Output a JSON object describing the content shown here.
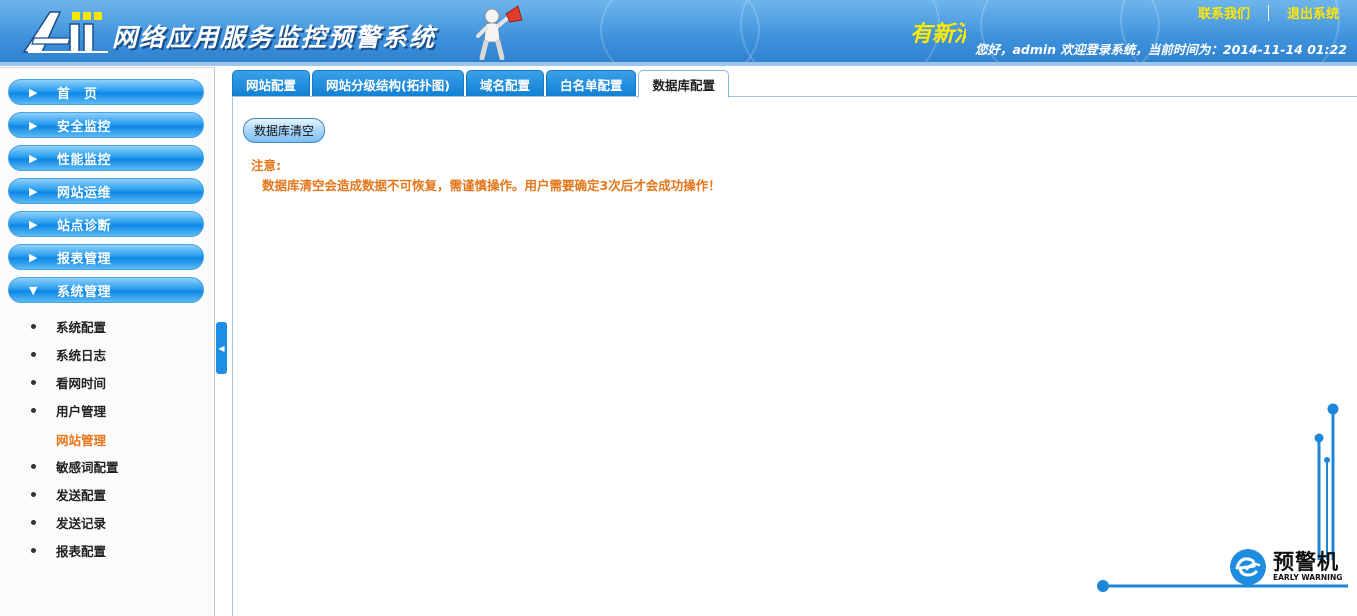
{
  "header": {
    "system_title": "网络应用服务监控预警系统",
    "marquee_text": "有新消息",
    "links": {
      "contact": "联系我们",
      "logout": "退出系统"
    },
    "welcome_text": "您好，admin 欢迎登录系统，当前时间为：2014-11-14 01:22"
  },
  "sidebar": {
    "menus": [
      {
        "label": "首　页",
        "arrow": "▶",
        "expanded": false
      },
      {
        "label": "安全监控",
        "arrow": "▶",
        "expanded": false
      },
      {
        "label": "性能监控",
        "arrow": "▶",
        "expanded": false
      },
      {
        "label": "网站运维",
        "arrow": "▶",
        "expanded": false
      },
      {
        "label": "站点诊断",
        "arrow": "▶",
        "expanded": false
      },
      {
        "label": "报表管理",
        "arrow": "▶",
        "expanded": false
      },
      {
        "label": "系统管理",
        "arrow": "▼",
        "expanded": true
      }
    ],
    "submenu": [
      {
        "label": "系统配置",
        "active": false
      },
      {
        "label": "系统日志",
        "active": false
      },
      {
        "label": "看网时间",
        "active": false
      },
      {
        "label": "用户管理",
        "active": false
      },
      {
        "label": "网站管理",
        "active": true
      },
      {
        "label": "敏感词配置",
        "active": false
      },
      {
        "label": "发送配置",
        "active": false
      },
      {
        "label": "发送记录",
        "active": false
      },
      {
        "label": "报表配置",
        "active": false
      }
    ],
    "collapse_glyph": "◀"
  },
  "main": {
    "tabs": [
      {
        "label": "网站配置",
        "active": false
      },
      {
        "label": "网站分级结构(拓扑图)",
        "active": false
      },
      {
        "label": "域名配置",
        "active": false
      },
      {
        "label": "白名单配置",
        "active": false
      },
      {
        "label": "数据库配置",
        "active": true
      }
    ],
    "clear_button": "数据库清空",
    "note_title": "注意:",
    "note_text": "数据库清空会造成数据不可恢复，需谨慎操作。用户需要确定3次后才会成功操作！"
  },
  "brand": {
    "name_cn": "预警机",
    "name_en": "EARLY WARNING"
  },
  "colors": {
    "header_blue": "#3f93dd",
    "accent_yellow": "#ffe600",
    "warning_orange": "#e4761a",
    "menu_blue": "#0e86e4"
  },
  "icons": {
    "logo": "ait-logo-icon",
    "mascot": "megaphone-mascot-icon",
    "brand_logo": "early-warning-logo-icon"
  }
}
